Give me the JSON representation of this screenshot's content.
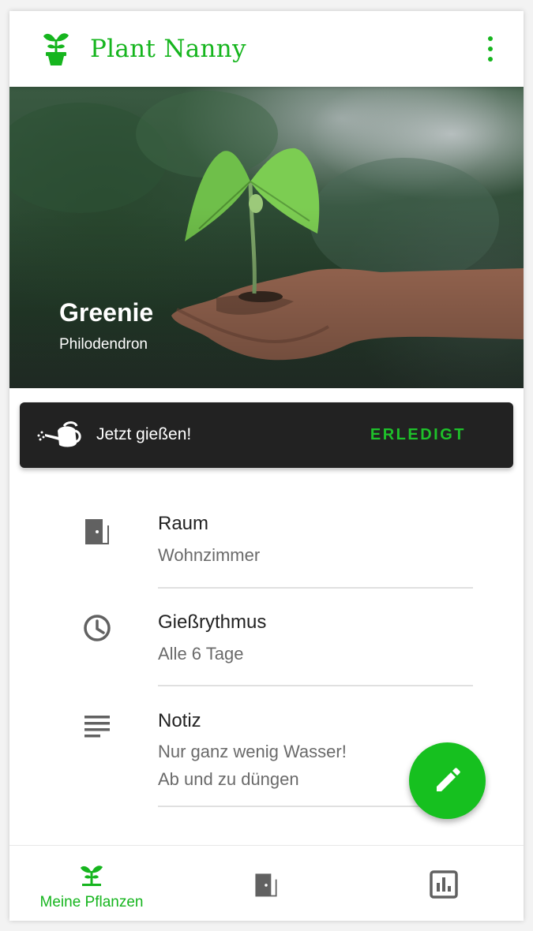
{
  "app": {
    "title": "Plant Nanny",
    "logo_icon": "plant-pot-icon",
    "menu_icon": "more-vert-icon",
    "accent": "#16b51e"
  },
  "plant": {
    "name": "Greenie",
    "species": "Philodendron"
  },
  "reminder": {
    "icon": "watering-can-icon",
    "text": "Jetzt gießen!",
    "action_label": "ERLEDIGT"
  },
  "details": [
    {
      "icon": "door-icon",
      "label": "Raum",
      "value": "Wohnzimmer"
    },
    {
      "icon": "clock-icon",
      "label": "Gießrythmus",
      "value": "Alle 6 Tage"
    },
    {
      "icon": "notes-icon",
      "label": "Notiz",
      "value": "Nur ganz wenig Wasser!\nAb und zu düngen"
    }
  ],
  "fab": {
    "icon": "pencil-icon"
  },
  "bottom_nav": [
    {
      "icon": "sprout-icon",
      "label": "Meine Pflanzen",
      "active": true
    },
    {
      "icon": "door-icon",
      "label": "",
      "active": false
    },
    {
      "icon": "bar-chart-icon",
      "label": "",
      "active": false
    }
  ]
}
